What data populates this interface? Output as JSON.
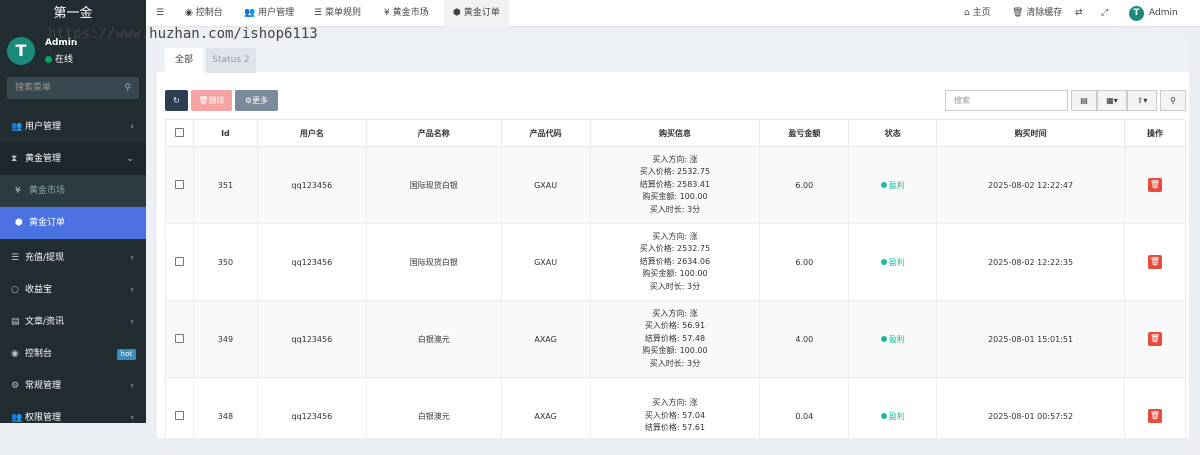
{
  "brand": "第一金",
  "user": {
    "name": "Admin",
    "status": "在线",
    "avatar_letter": "T"
  },
  "search_placeholder": "搜索菜单",
  "menu": [
    {
      "label": "用户管理",
      "icon": "users-icon",
      "arrow": "‹"
    },
    {
      "label": "黄金管理",
      "icon": "hourglass-icon",
      "arrow": "⌄"
    },
    {
      "label": "黄金市场",
      "icon": "yen-icon"
    },
    {
      "label": "黄金订单",
      "icon": "cube-icon"
    },
    {
      "label": "充值/提现",
      "icon": "list-icon",
      "arrow": "‹"
    },
    {
      "label": "收益宝",
      "icon": "circle-icon",
      "arrow": "‹"
    },
    {
      "label": "文章/资讯",
      "icon": "newspaper-icon",
      "arrow": "‹"
    },
    {
      "label": "控制台",
      "icon": "dashboard-icon",
      "badge": "hot"
    },
    {
      "label": "常规管理",
      "icon": "cogs-icon",
      "arrow": "‹"
    },
    {
      "label": "权限管理",
      "icon": "group-icon",
      "arrow": "‹"
    }
  ],
  "topnav": [
    "控制台",
    "用户管理",
    "菜单规则",
    "黄金市场",
    "黄金订单"
  ],
  "topright": {
    "home": "主页",
    "clear": "清除缓存",
    "admin": "Admin"
  },
  "watermark": "https://www.huzhan.com/ishop6113",
  "tabs": [
    "全部",
    "Status 2"
  ],
  "toolbar": {
    "delete": "删除",
    "more": "更多",
    "search_placeholder": "搜索"
  },
  "columns": [
    "Id",
    "用户名",
    "产品名称",
    "产品代码",
    "购买信息",
    "盈亏金额",
    "状态",
    "购买时间",
    "操作"
  ],
  "rows": [
    {
      "id": "351",
      "user": "qq123456",
      "product": "国际现货白银",
      "code": "GXAU",
      "dir": "买入方向: 涨",
      "buy_price": "买入价格: 2532.75",
      "settle": "结算价格: 2583.41",
      "amount": "购买金额: 100.00",
      "duration": "买入时长: 3分",
      "pnl": "6.00",
      "status": "盈利",
      "time": "2025-08-02 12:22:47"
    },
    {
      "id": "350",
      "user": "qq123456",
      "product": "国际现货白银",
      "code": "GXAU",
      "dir": "买入方向: 涨",
      "buy_price": "买入价格: 2532.75",
      "settle": "结算价格: 2634.06",
      "amount": "购买金额: 100.00",
      "duration": "买入时长: 3分",
      "pnl": "6.00",
      "status": "盈利",
      "time": "2025-08-02 12:22:35"
    },
    {
      "id": "349",
      "user": "qq123456",
      "product": "白银澳元",
      "code": "AXAG",
      "dir": "买入方向: 涨",
      "buy_price": "买入价格: 56.91",
      "settle": "结算价格: 57.48",
      "amount": "购买金额: 100.00",
      "duration": "买入时长: 3分",
      "pnl": "4.00",
      "status": "盈利",
      "time": "2025-08-01 15:01:51"
    },
    {
      "id": "348",
      "user": "qq123456",
      "product": "白银澳元",
      "code": "AXAG",
      "dir": "买入方向: 涨",
      "buy_price": "买入价格: 57.04",
      "settle": "结算价格: 57.61",
      "amount": "",
      "duration": "",
      "pnl": "0.04",
      "status": "盈利",
      "time": "2025-08-01 00:57:52"
    }
  ]
}
